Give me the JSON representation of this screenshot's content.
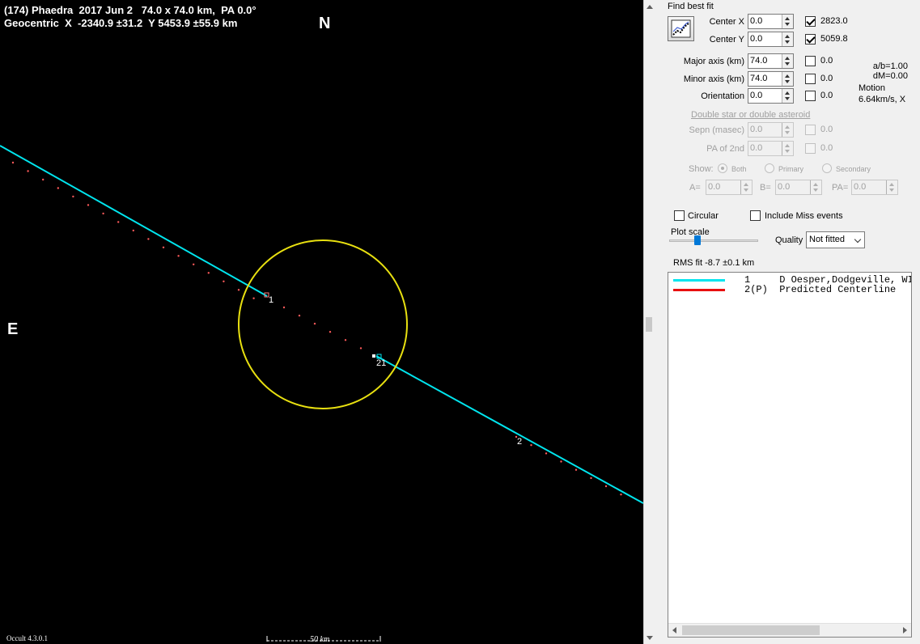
{
  "plot": {
    "title_line1": "(174) Phaedra  2017 Jun 2   74.0 x 74.0 km,  PA 0.0°",
    "title_line2": "Geocentric  X  -2340.9 ±31.2  Y 5453.9 ±55.9 km",
    "north_label": "N",
    "east_label": "E",
    "chord_labels": [
      "1",
      "21",
      "2"
    ],
    "scale_label": "50 km",
    "version": "Occult 4.3.0.1",
    "colors": {
      "background": "#000000",
      "chord": "#00e5ee",
      "ellipse": "#e8e010",
      "dots": "#ff5a5a"
    }
  },
  "panel": {
    "find_best_fit": "Find best fit",
    "fit_button_icon": "fit-plot-icon",
    "center_x": {
      "label": "Center X",
      "value": "0.0",
      "checked": true,
      "fit_value": "2823.0"
    },
    "center_y": {
      "label": "Center Y",
      "value": "0.0",
      "checked": true,
      "fit_value": "5059.8"
    },
    "major_axis": {
      "label": "Major axis (km)",
      "value": "74.0",
      "checked": false,
      "fit_value": "0.0"
    },
    "minor_axis": {
      "label": "Minor axis (km)",
      "value": "74.0",
      "checked": false,
      "fit_value": "0.0"
    },
    "orientation": {
      "label": "Orientation",
      "value": "0.0",
      "checked": false,
      "fit_value": "0.0"
    },
    "ratio_ab": "a/b=1.00",
    "dm": "dM=0.00",
    "motion_label": "Motion",
    "motion_value": "6.64km/s, X",
    "double_star_link": "Double star  or  double asteroid",
    "sepn": {
      "label": "Sepn (masec)",
      "value": "0.0",
      "fit_value": "0.0"
    },
    "pa2nd": {
      "label": "PA of 2nd",
      "value": "0.0",
      "fit_value": "0.0"
    },
    "show_label": "Show:",
    "show_options": [
      "Both",
      "Primary",
      "Secondary"
    ],
    "a_label": "A=",
    "a_value": "0.0",
    "b_label": "B=",
    "b_value": "0.0",
    "pa_label": "PA=",
    "pa_value": "0.0",
    "circular_label": "Circular",
    "include_miss_label": "Include Miss events",
    "plot_scale_label": "Plot scale",
    "quality_label": "Quality",
    "quality_value": "Not fitted",
    "rms_fit": "RMS fit -8.7 ±0.1 km",
    "legend": [
      {
        "text": "1     D Oesper,Dodgeville, WI",
        "color": "#00e5ee"
      },
      {
        "text": "2(P)  Predicted Centerline",
        "color": "#e81010"
      }
    ]
  }
}
